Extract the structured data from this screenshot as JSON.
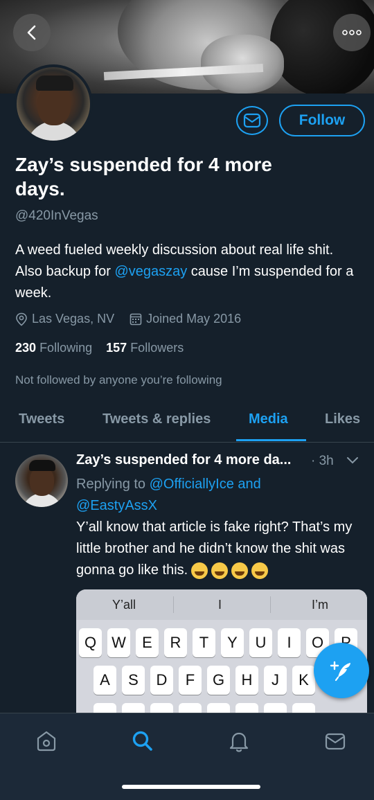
{
  "profile": {
    "name": "Zay’s suspended for 4 more days.",
    "handle": "@420InVegas",
    "follow_label": "Follow",
    "bio_part1": "A weed fueled weekly discussion about real life shit. Also backup for ",
    "bio_mention": "@vegaszay",
    "bio_part2": " cause I’m suspended for a week.",
    "location": "Las Vegas, NV",
    "joined": "Joined May 2016",
    "following_count": "230",
    "following_label": "Following",
    "followers_count": "157",
    "followers_label": "Followers",
    "not_followed": "Not followed by anyone you’re following"
  },
  "tabs": [
    {
      "label": "Tweets"
    },
    {
      "label": "Tweets & replies"
    },
    {
      "label": "Media"
    },
    {
      "label": "Likes"
    }
  ],
  "active_tab": "Media",
  "tweet": {
    "name": "Zay’s suspended for 4 more da...",
    "time": "· 3h",
    "replying_label": "Replying to ",
    "reply_mention1": "@OfficiallyIce",
    "reply_and": " and",
    "reply_mention2": "@EastyAssX",
    "text": "Y’all know that article is fake right? That’s my little brother and he didn’t know the shit was gonna go like this."
  },
  "keyboard": {
    "suggestions": [
      "Y’all",
      "I",
      "I’m"
    ],
    "row1": [
      "Q",
      "W",
      "E",
      "R",
      "T",
      "Y",
      "U",
      "I",
      "O",
      "P"
    ],
    "row2": [
      "A",
      "S",
      "D",
      "F",
      "G",
      "H",
      "J",
      "K"
    ]
  },
  "icons": {
    "back": "back-arrow-icon",
    "more": "more-dots-icon",
    "mail": "envelope-icon",
    "compose": "compose-feather-icon",
    "nav": [
      "home-icon",
      "search-icon",
      "notifications-icon",
      "messages-icon"
    ]
  },
  "colors": {
    "background": "#15202b",
    "accent": "#1da1f2",
    "secondary_text": "#8899a6"
  }
}
